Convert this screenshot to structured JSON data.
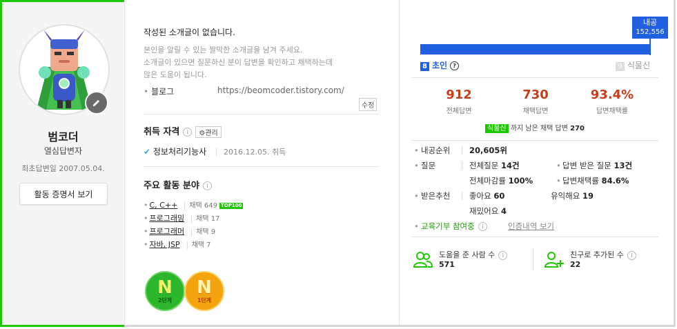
{
  "profile": {
    "name": "범코더",
    "rank": "열심답변자",
    "first_answer": "최초답변일 2007.05.04.",
    "cert_button": "활동 증명서 보기"
  },
  "intro": {
    "title": "작성된 소개글이 없습니다.",
    "help_line1": "본인을 알릴 수 있는 짤막한 소개글을 남겨 주세요.",
    "help_line2": "소개글이 있으면 질문하신 분이 답변을 확인하고 채택하는데",
    "help_line3": "많은 도움이 됩니다.",
    "blog_label": "블로그",
    "blog_url": "https://beomcoder.tistory.com/",
    "edit_label": "수정"
  },
  "license": {
    "title": "취득 자격",
    "info": "i",
    "manage_label": "관리",
    "items": [
      {
        "name": "정보처리기능사",
        "date": "2016.12.05. 취득"
      }
    ]
  },
  "fields": {
    "title": "주요 활동 분야",
    "items": [
      {
        "name": "C, C++",
        "count": "채택 649",
        "badge": "TOP100"
      },
      {
        "name": "프로그래밍",
        "count": "채택 17"
      },
      {
        "name": "프로그래머",
        "count": "채택 9"
      },
      {
        "name": "자바, JSP",
        "count": "채택 7"
      }
    ]
  },
  "badges": [
    {
      "letter": "N",
      "level": "2단계",
      "color": "#2bb62b"
    },
    {
      "letter": "N",
      "level": "1단계",
      "color": "#f4a40f"
    }
  ],
  "level": {
    "tip_label": "내공",
    "tip_value": "152,556",
    "progress": 1.0,
    "current_num": "8",
    "current_name": "초인",
    "help": "?",
    "next_num": "9",
    "next_name": "식물신"
  },
  "stats": [
    {
      "value": "912",
      "label": "전체답변"
    },
    {
      "value": "730",
      "label": "채택답변"
    },
    {
      "value": "93.4%",
      "label": "답변채택률"
    }
  ],
  "next_level": {
    "pill": "식물신",
    "text": " 까지 남은 채택 답변 ",
    "remaining": "270"
  },
  "details": {
    "rank_label": "내공순위",
    "rank_value": "20,605위",
    "question_label": "질문",
    "total_q_label": "전체질문",
    "total_q_value": "14건",
    "answered_q_label": "답변 받은 질문",
    "answered_q_value": "13건",
    "closed_rate_label": "전체마감률",
    "closed_rate_value": "100%",
    "adopt_rate_label": "답변채택률",
    "adopt_rate_value": "84.6%",
    "rec_label": "받은추천",
    "good_label": "좋아요",
    "good_value": "60",
    "useful_label": "유익해요",
    "useful_value": "19",
    "fun_label": "재밌어요",
    "fun_value": "4",
    "edu_label": "교육기부 참여중",
    "edu_link": "인증내역 보기"
  },
  "people": {
    "helped_label": "도움을 준 사람 수",
    "helped_value": "571",
    "friends_label": "친구로 추가된 수",
    "friends_value": "22"
  },
  "colors": {
    "accent_green": "#1ec800",
    "level_blue": "#1f5fe0",
    "stat_red": "#c63d1a"
  }
}
